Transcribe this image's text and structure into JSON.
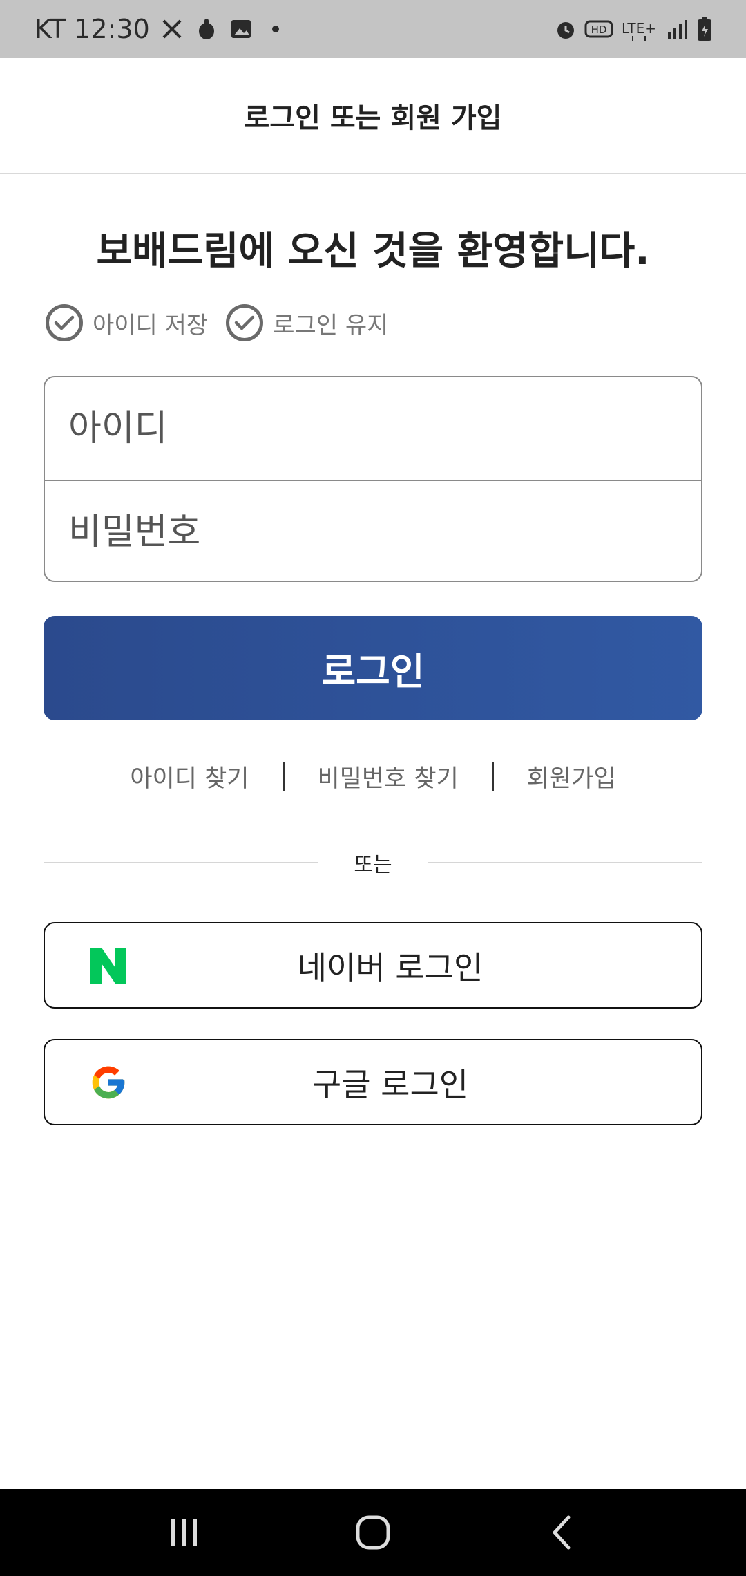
{
  "status_bar": {
    "carrier_time": "KT 12:30",
    "icons_left": [
      "missed-call-icon",
      "hand-icon",
      "gallery-icon",
      "dot-icon"
    ],
    "icons_right": [
      "alarm-icon",
      "hd-icon",
      "lte-plus-icon",
      "signal-icon",
      "battery-icon"
    ],
    "hd_label": "HD",
    "lte_label": "LTE+"
  },
  "header": {
    "title": "로그인 또는 회원 가입"
  },
  "welcome_text": "보배드림에 오신 것을 환영합니다.",
  "options": {
    "save_id": "아이디 저장",
    "keep_login": "로그인 유지"
  },
  "form": {
    "id_placeholder": "아이디",
    "password_placeholder": "비밀번호",
    "login_button": "로그인"
  },
  "links": {
    "find_id": "아이디 찾기",
    "find_password": "비밀번호 찾기",
    "signup": "회원가입"
  },
  "divider_text": "또는",
  "social": {
    "naver_label": "네이버 로그인",
    "google_label": "구글 로그인"
  },
  "colors": {
    "status_bar": "#c4c4c4",
    "primary_button": "#2f539b",
    "naver_green": "#03c75a",
    "nav_bar": "#000000"
  }
}
